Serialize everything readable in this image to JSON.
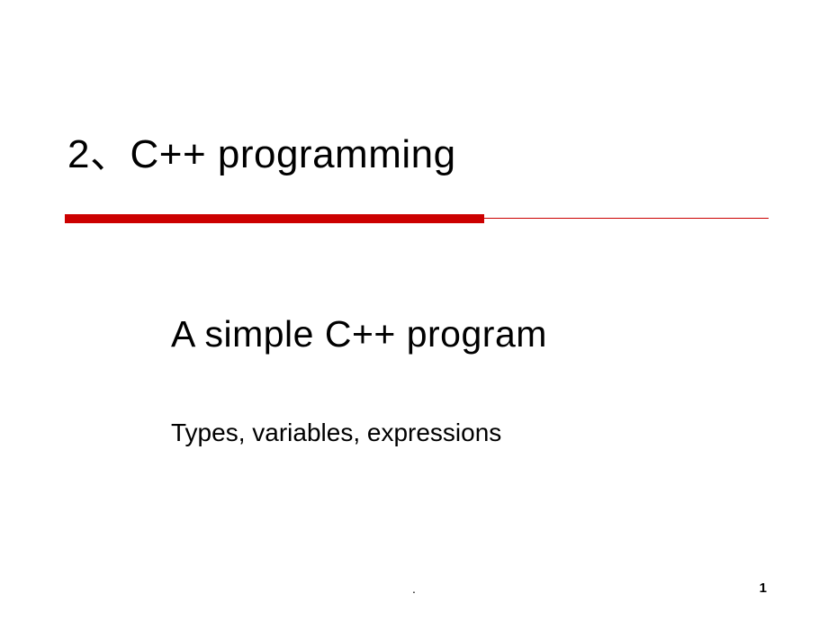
{
  "slide": {
    "title": "2、C++ programming",
    "subtitle": "A simple C++ program",
    "subtext": "Types, variables, expressions",
    "footer_mark": ".",
    "page_number": "1"
  }
}
